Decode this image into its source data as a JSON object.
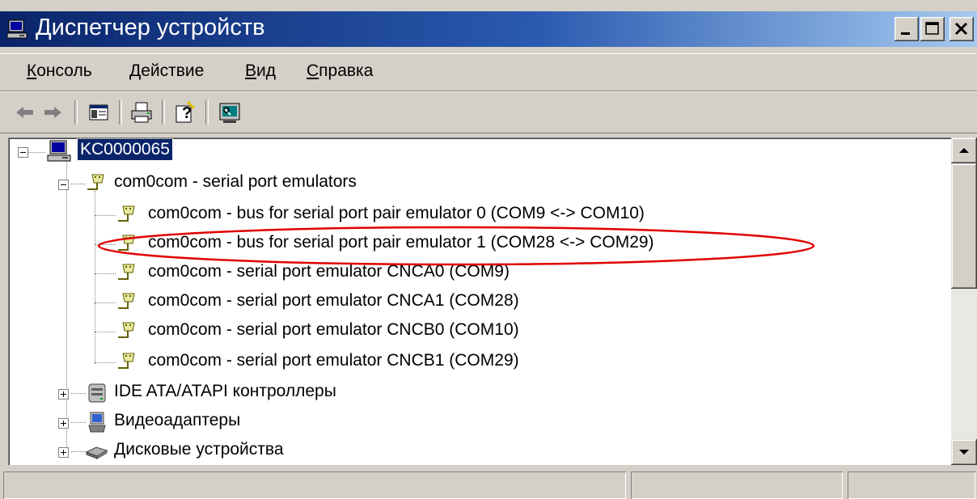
{
  "window": {
    "title": "Диспетчер устройств"
  },
  "menu": [
    {
      "access": "К",
      "rest": "онсоль"
    },
    {
      "access": "Д",
      "rest": "ействие"
    },
    {
      "access": "В",
      "rest": "ид"
    },
    {
      "access": "С",
      "rest": "правка"
    }
  ],
  "tree": {
    "root": "KC0000065",
    "group": "com0com - serial port emulators",
    "children": [
      "com0com - bus for serial port pair emulator 0 (COM9 <-> COM10)",
      "com0com - bus for serial port pair emulator 1 (COM28 <-> COM29)",
      "com0com - serial port emulator CNCA0 (COM9)",
      "com0com - serial port emulator CNCA1 (COM28)",
      "com0com - serial port emulator CNCB0 (COM10)",
      "com0com - serial port emulator CNCB1 (COM29)"
    ],
    "categories": [
      "IDE ATA/ATAPI контроллеры",
      "Видеоадаптеры",
      "Дисковые устройства"
    ]
  },
  "status": [
    "",
    "",
    ""
  ],
  "colors": {
    "title_bar_start": "#0a246a",
    "title_bar_end": "#a6caf0",
    "selection": "#0a246a",
    "annotation": "#e00000",
    "chrome": "#d4d0c8"
  }
}
